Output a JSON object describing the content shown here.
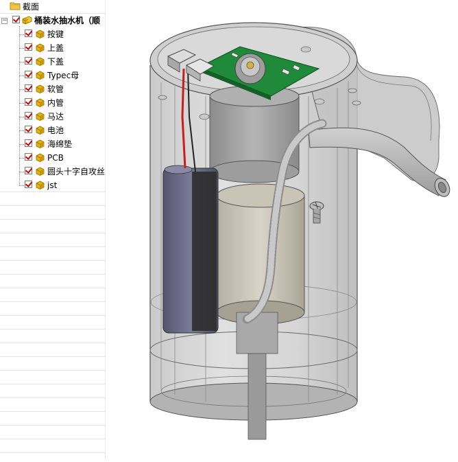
{
  "tree": {
    "section_label": "截面",
    "assembly_label": "桶装水抽水机（顺",
    "parts": [
      {
        "label": "按键"
      },
      {
        "label": "上盖"
      },
      {
        "label": "下盖"
      },
      {
        "label": "Typec母"
      },
      {
        "label": "软管"
      },
      {
        "label": "内管"
      },
      {
        "label": "马达"
      },
      {
        "label": "电池"
      },
      {
        "label": "海绵垫"
      },
      {
        "label": "PCB"
      },
      {
        "label": "圆头十字自攻丝"
      },
      {
        "label": "jst"
      }
    ]
  },
  "colors": {
    "check_mark": "#d00000",
    "part_icon": "#e8b400",
    "pcb": "#1e8a3a",
    "battery": "#6a6a84"
  }
}
